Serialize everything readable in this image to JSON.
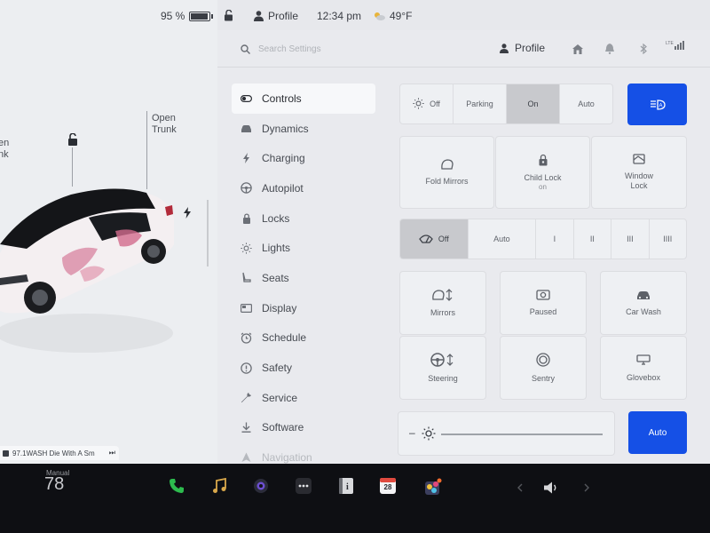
{
  "status": {
    "battery_percent": "95 %",
    "battery_level": 0.95,
    "profile": "Profile",
    "time": "12:34 pm",
    "temperature": "49°F"
  },
  "car": {
    "open_frunk": "Open\nFrunk",
    "open_frunk_visible": "en\nnk",
    "open_trunk": "Open\nTrunk"
  },
  "media": {
    "now_playing": "97.1WASH Die With A Sm",
    "next_glyph": "⏭"
  },
  "search": {
    "placeholder": "Search Settings"
  },
  "header": {
    "profile_label": "Profile",
    "lte_label": "LTE"
  },
  "menu": [
    {
      "label": "Controls",
      "icon": "toggle-icon",
      "active": true
    },
    {
      "label": "Dynamics",
      "icon": "car-icon"
    },
    {
      "label": "Charging",
      "icon": "bolt-icon"
    },
    {
      "label": "Autopilot",
      "icon": "steering-wheel-icon"
    },
    {
      "label": "Locks",
      "icon": "lock-icon"
    },
    {
      "label": "Lights",
      "icon": "sun-icon"
    },
    {
      "label": "Seats",
      "icon": "seat-icon"
    },
    {
      "label": "Display",
      "icon": "display-icon"
    },
    {
      "label": "Schedule",
      "icon": "clock-icon"
    },
    {
      "label": "Safety",
      "icon": "alert-icon"
    },
    {
      "label": "Service",
      "icon": "wrench-icon"
    },
    {
      "label": "Software",
      "icon": "download-icon"
    },
    {
      "label": "Navigation",
      "icon": "navigation-icon"
    }
  ],
  "lights": {
    "options": [
      "Off",
      "Parking",
      "On",
      "Auto"
    ],
    "selected": "On"
  },
  "tiles_row1": [
    {
      "label": "Fold Mirrors",
      "sub": ""
    },
    {
      "label": "Child Lock",
      "sub": "on"
    },
    {
      "label": "Window\nLock",
      "sub": ""
    }
  ],
  "wipers": {
    "options": [
      "Off",
      "Auto",
      "I",
      "II",
      "III",
      "IIII"
    ],
    "selected": "Off"
  },
  "tiles_grid": [
    {
      "label": "Mirrors"
    },
    {
      "label": "Paused"
    },
    {
      "label": "Car Wash"
    },
    {
      "label": "Steering"
    },
    {
      "label": "Sentry"
    },
    {
      "label": "Glovebox"
    }
  ],
  "brightness": {
    "auto_label": "Auto",
    "minus": "–"
  },
  "taskbar": {
    "temp_mode": "Manual",
    "temp_value": "78",
    "calendar_day": "28"
  },
  "colors": {
    "accent_blue": "#1550e6",
    "phone_green": "#2dbb4e",
    "screen_bg": "#e7e8ec",
    "taskbar_bg": "#0e0f13"
  }
}
